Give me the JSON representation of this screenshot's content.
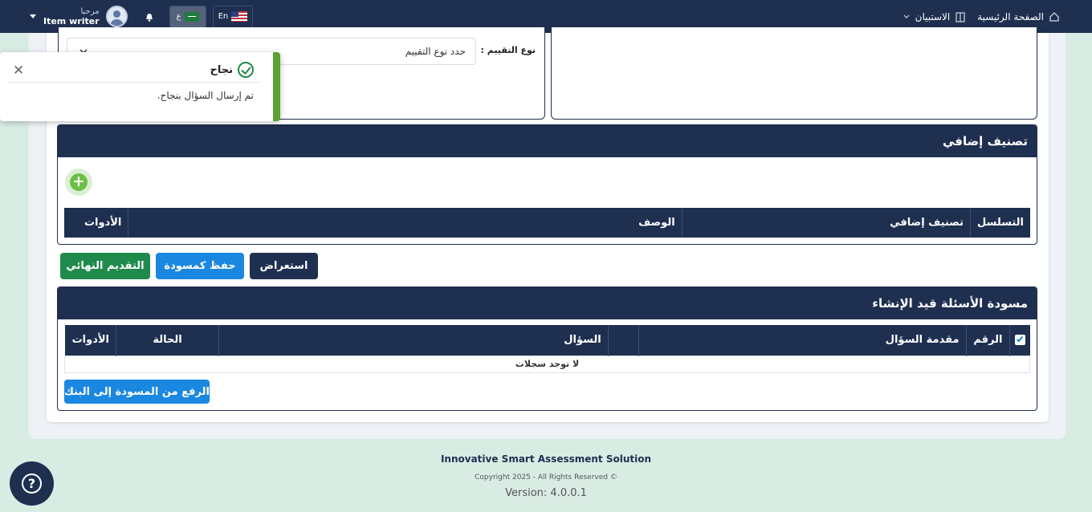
{
  "navbar": {
    "home_label": "الصفحة الرئيسية",
    "survey_label": "الاستبيان",
    "user_greeting": "مرحبا",
    "user_name": "Item writer",
    "lang_ar_label": "ع",
    "lang_en_label": "En"
  },
  "form": {
    "evaluation_type_label": "نوع التقييم :",
    "evaluation_type_placeholder": "حدد نوع التقييم"
  },
  "toast": {
    "title": "نجاح",
    "message": "تم إرسال السؤال بنجاح.",
    "close_symbol": "✕"
  },
  "additional_classification": {
    "title": "تصنيف إضافي",
    "add_symbol": "+",
    "columns": [
      "التسلسل",
      "تصنيف إضافي",
      "الوصف",
      "الأدوات"
    ]
  },
  "actions": {
    "preview_label": "استعراض",
    "save_draft_label": "حفظ كمسودة",
    "final_submit_label": "التقديم النهائي"
  },
  "drafts": {
    "title": "مسودة الأسئلة قيد الإنشاء",
    "columns": [
      "الرقم",
      "مقدمة السؤال",
      "",
      "السؤال",
      "الحالة",
      "الأدوات"
    ],
    "empty_text": "لا توجد سجلات",
    "upload_label": "الرفع من المسودة إلى البنك"
  },
  "footer": {
    "product_name": "Innovative Smart Assessment Solution",
    "copyright": "Copyright 2025 - All Rights Reserved ©",
    "version": "Version: 4.0.0.1"
  },
  "colors": {
    "navy": "#1e2f50",
    "blue": "#1a87e0",
    "green": "#1f8a4c",
    "success": "#5aa232"
  }
}
